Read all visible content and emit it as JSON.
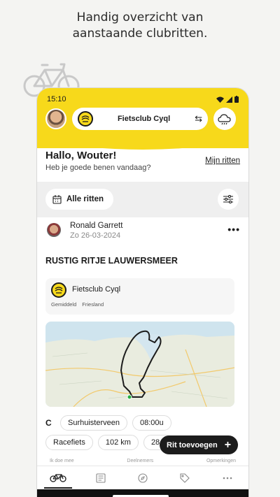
{
  "headline": {
    "line1": "Handig overzicht van",
    "line2": "aanstaande clubritten."
  },
  "status": {
    "time": "15:10"
  },
  "header": {
    "club_name": "Fietsclub Cyql",
    "swap_icon": "swap-arrows-icon",
    "weather_icon": "cloud-sun-icon"
  },
  "greeting": {
    "title": "Hallo, Wouter!",
    "subtitle": "Heb je goede benen vandaag?",
    "my_rides_link": "Mijn ritten"
  },
  "filter": {
    "all_rides_label": "Alle ritten"
  },
  "ride": {
    "owner_name": "Ronald Garrett",
    "owner_date": "Zo  26-03-2024",
    "title": "RUSTIG RITJE LAUWERSMEER",
    "club": {
      "name": "Fietsclub Cyql",
      "tags": [
        "Gemiddeld",
        "Friesland"
      ]
    },
    "category": "C",
    "start_place": "Surhuisterveen",
    "start_time": "08:00u",
    "bike_type": "Racefiets",
    "distance": "102 km",
    "speed": "28 k"
  },
  "fab": {
    "label": "Rit toevoegen"
  },
  "footer_labels": [
    "Ik doe mee",
    "Deelnemers",
    "Opmerkingen"
  ],
  "tabs": [
    {
      "icon": "bike-icon",
      "active": true
    },
    {
      "icon": "newspaper-icon",
      "active": false
    },
    {
      "icon": "compass-icon",
      "active": false
    },
    {
      "icon": "tags-icon",
      "active": false
    },
    {
      "icon": "more-icon",
      "active": false
    }
  ],
  "colors": {
    "brand_yellow": "#f7d91b",
    "dark": "#1c1c1c",
    "route_green": "#27b040"
  }
}
